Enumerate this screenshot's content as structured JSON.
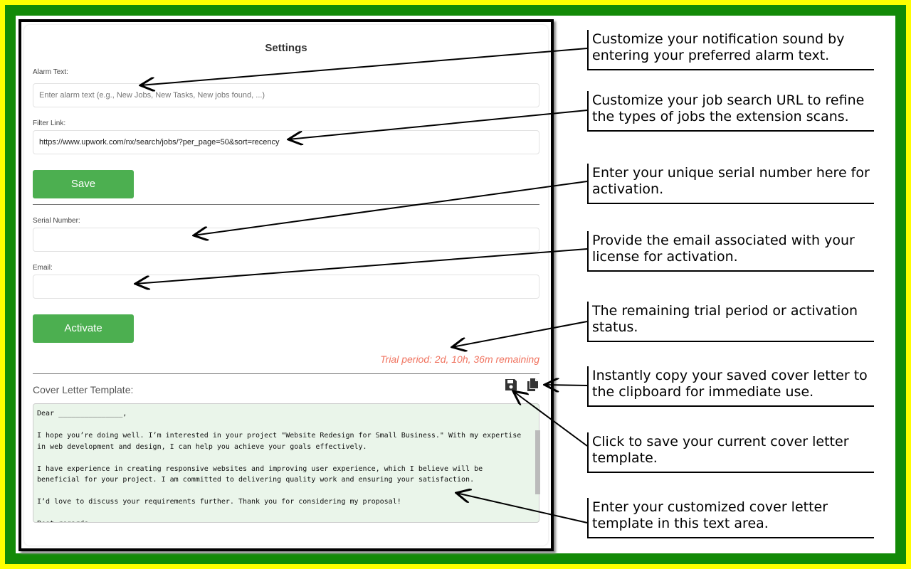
{
  "settings": {
    "title": "Settings",
    "alarm_label": "Alarm Text:",
    "alarm_placeholder": "Enter alarm text (e.g., New Jobs, New Tasks, New jobs found, ...)",
    "filter_label": "Filter Link:",
    "filter_value": "https://www.upwork.com/nx/search/jobs/?per_page=50&sort=recency",
    "save_label": "Save",
    "serial_label": "Serial Number:",
    "serial_value": "",
    "email_label": "Email:",
    "email_value": "",
    "activate_label": "Activate",
    "trial_status": "Trial period: 2d, 10h, 36m remaining",
    "cover_label": "Cover Letter Template:",
    "cover_text": "Dear _______________,\n\nI hope you’re doing well. I’m interested in your project \"Website Redesign for Small Business.\" With my expertise in web development and design, I can help you achieve your goals effectively.\n\nI have experience in creating responsive websites and improving user experience, which I believe will be beneficial for your project. I am committed to delivering quality work and ensuring your satisfaction.\n\nI’d love to discuss your requirements further. Thank you for considering my proposal!\n\nBest regards,"
  },
  "callouts": [
    "Customize your notification sound by entering your preferred alarm text.",
    "Customize your job search URL to refine the types of jobs the extension scans.",
    "Enter your unique serial number here for activation.",
    "Provide the email associated with your license for activation.",
    "The remaining trial period or activation status.",
    "Instantly copy your saved cover letter to the clipboard for immediate use.",
    "Click to save your current cover letter template.",
    "Enter your customized cover letter template in this text area."
  ],
  "colors": {
    "button": "#4caf50",
    "trial": "#f0735f",
    "textarea_bg": "#eaf5ea",
    "frame_outer": "#ffff00",
    "frame_inner": "#138a07"
  }
}
